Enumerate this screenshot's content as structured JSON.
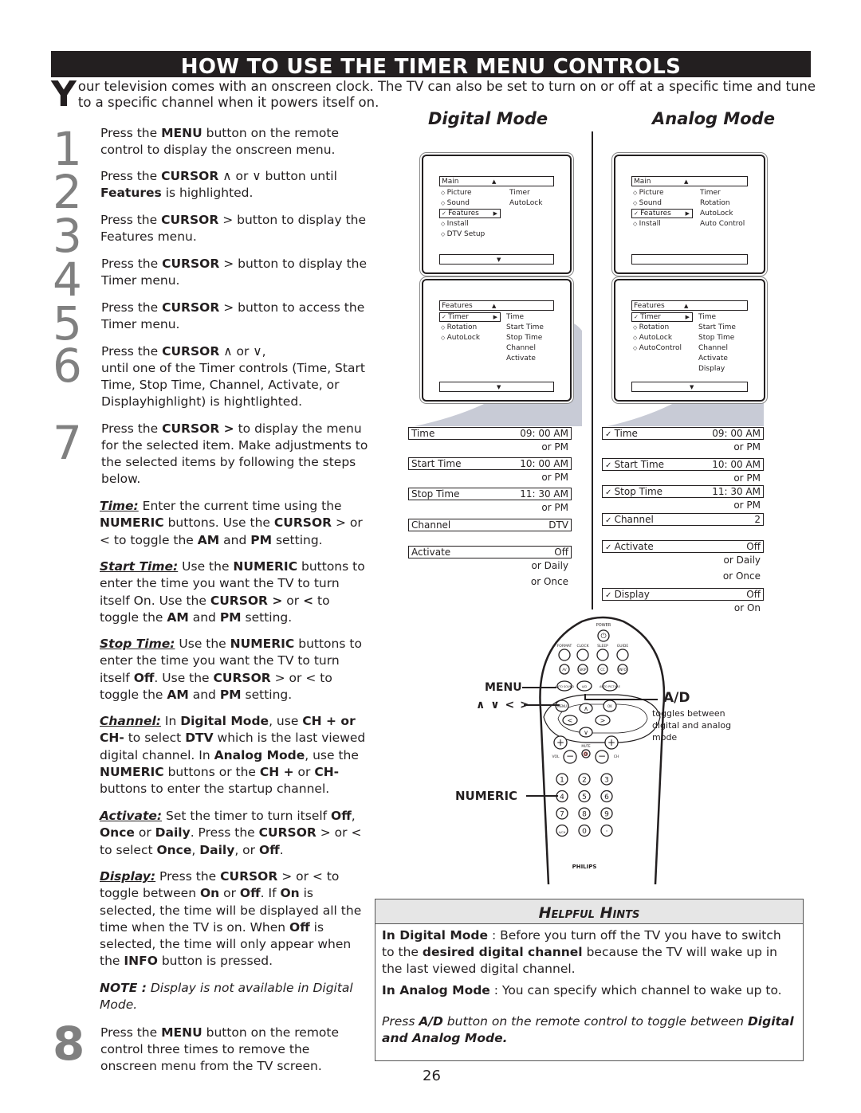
{
  "page": {
    "title": "HOW TO USE THE TIMER MENU CONTROLS",
    "intro_cap": "Y",
    "intro_rest": "our television comes with an onscreen clock. The TV can also be set to turn on or off at a specific time and tune to a specific channel when it powers itself on.",
    "page_number": "26"
  },
  "steps": [
    {
      "num": "1",
      "parts": [
        [
          "Press the ",
          false
        ],
        [
          "MENU",
          true
        ],
        [
          " button on the remote control to display the onscreen menu.",
          false
        ]
      ]
    },
    {
      "num": "2",
      "parts": [
        [
          "Press the ",
          false
        ],
        [
          "CURSOR",
          true
        ],
        [
          " ∧  or ∨ button until ",
          false
        ],
        [
          "Features",
          true
        ],
        [
          " is highlighted.",
          false
        ]
      ]
    },
    {
      "num": "3",
      "parts": [
        [
          "Press the ",
          false
        ],
        [
          "CURSOR",
          true
        ],
        [
          " > button to display the Features menu.",
          false
        ]
      ]
    },
    {
      "num": "4",
      "parts": [
        [
          "Press the ",
          false
        ],
        [
          "CURSOR",
          true
        ],
        [
          " > button to display the Timer menu.",
          false
        ]
      ]
    },
    {
      "num": "5",
      "parts": [
        [
          "Press the ",
          false
        ],
        [
          "CURSOR",
          true
        ],
        [
          " > button to access the Timer menu.",
          false
        ]
      ]
    },
    {
      "num": "6",
      "parts": [
        [
          "Press the ",
          false
        ],
        [
          "CURSOR",
          true
        ],
        [
          " ∧  or ∨,",
          false
        ],
        [
          "\n",
          false
        ],
        [
          "until one of the Timer controls (Time, Start Time, Stop Time, Channel, Activate, or Displayhighlight) is hightlighted.",
          false
        ]
      ]
    },
    {
      "num": "7",
      "parts": [
        [
          "Press the ",
          false
        ],
        [
          "CURSOR >",
          true
        ],
        [
          " to display the menu for the selected item.  Make adjustments to the selected items by following the steps below.",
          false
        ]
      ]
    },
    {
      "num": "8",
      "parts": [
        [
          "Press the ",
          false
        ],
        [
          "MENU",
          true
        ],
        [
          " button on the remote control three times to remove the onscreen menu from the TV screen.",
          false
        ]
      ]
    }
  ],
  "sections": [
    {
      "label": "Time:",
      "parts": [
        [
          " Enter the current time using the ",
          false
        ],
        [
          "NUMERIC",
          true
        ],
        [
          " buttons. Use the ",
          false
        ],
        [
          "CURSOR",
          true
        ],
        [
          " > or < to toggle the ",
          false
        ],
        [
          "AM",
          true
        ],
        [
          " and ",
          false
        ],
        [
          "PM",
          true
        ],
        [
          " setting.",
          false
        ]
      ]
    },
    {
      "label": "Start Time:",
      "parts": [
        [
          " Use the ",
          false
        ],
        [
          "NUMERIC",
          true
        ],
        [
          " buttons to enter      the time you want the TV to turn itself On.  Use the ",
          false
        ],
        [
          "CURSOR >",
          true
        ],
        [
          " or ",
          false
        ],
        [
          "<",
          true
        ],
        [
          " to toggle the ",
          false
        ],
        [
          "AM",
          true
        ],
        [
          " and ",
          false
        ],
        [
          "PM",
          true
        ],
        [
          " setting.",
          false
        ]
      ]
    },
    {
      "label": "Stop Time:",
      "parts": [
        [
          " Use the ",
          false
        ],
        [
          "NUMERIC",
          true
        ],
        [
          " buttons to enter the time you want the TV to turn itself ",
          false
        ],
        [
          "Off",
          true
        ],
        [
          ". Use the ",
          false
        ],
        [
          "CURSOR",
          true
        ],
        [
          " > or < to toggle the ",
          false
        ],
        [
          "AM",
          true
        ],
        [
          " and ",
          false
        ],
        [
          "PM",
          true
        ],
        [
          " setting.",
          false
        ]
      ]
    },
    {
      "label": "Channel:",
      "parts": [
        [
          " In ",
          false
        ],
        [
          "Digital Mode",
          true
        ],
        [
          ", use ",
          false
        ],
        [
          "CH + or CH-",
          true
        ],
        [
          "  to select ",
          false
        ],
        [
          "DTV",
          true
        ],
        [
          " which is the last viewed digital channel.   In ",
          false
        ],
        [
          "Analog Mode",
          true
        ],
        [
          ", use the ",
          false
        ],
        [
          "NUMERIC",
          true
        ],
        [
          " buttons or the ",
          false
        ],
        [
          "CH +",
          true
        ],
        [
          " or ",
          false
        ],
        [
          "CH-",
          true
        ],
        [
          " buttons to enter the startup channel.",
          false
        ]
      ]
    },
    {
      "label": "Activate:",
      "parts": [
        [
          " Set the timer to turn itself ",
          false
        ],
        [
          "Off",
          true
        ],
        [
          ", ",
          false
        ],
        [
          "Once",
          true
        ],
        [
          " or ",
          false
        ],
        [
          "Daily",
          true
        ],
        [
          ". Press the ",
          false
        ],
        [
          "CURSOR",
          true
        ],
        [
          " > or < to select ",
          false
        ],
        [
          "Once",
          true
        ],
        [
          ", ",
          false
        ],
        [
          "Daily",
          true
        ],
        [
          ", or ",
          false
        ],
        [
          "Off",
          true
        ],
        [
          ".",
          false
        ]
      ]
    },
    {
      "label": "Display:",
      "parts": [
        [
          " Press the ",
          false
        ],
        [
          "CURSOR",
          true
        ],
        [
          " > or < to toggle between ",
          false
        ],
        [
          "On",
          true
        ],
        [
          " or ",
          false
        ],
        [
          "Off",
          true
        ],
        [
          ".  If ",
          false
        ],
        [
          "On",
          true
        ],
        [
          " is selected, the time will be displayed all the time when the TV is on.   When ",
          false
        ],
        [
          "Off",
          true
        ],
        [
          " is selected, the time will only appear when the ",
          false
        ],
        [
          "INFO",
          true
        ],
        [
          " button is pressed.",
          false
        ]
      ]
    }
  ],
  "note": {
    "label": "NOTE :",
    "text": " Display is not available in Digital Mode."
  },
  "digital": {
    "title": "Digital Mode",
    "main_menu": {
      "header": "Main",
      "items": [
        "Picture",
        "Sound",
        "Features",
        "Install",
        "DTV Setup"
      ],
      "selected": "Features",
      "sub": [
        "Timer",
        "AutoLock"
      ]
    },
    "features_menu": {
      "header": "Features",
      "items": [
        "Timer",
        "Rotation",
        "AutoLock"
      ],
      "selected": "Timer",
      "sub": [
        "Time",
        "Start Time",
        "Stop Time",
        "Channel",
        "Activate"
      ]
    },
    "fields": [
      {
        "label": "Time",
        "value": "09: 00 AM",
        "alts": [
          "or PM"
        ]
      },
      {
        "label": "Start Time",
        "value": "10: 00 AM",
        "alts": [
          "or PM"
        ]
      },
      {
        "label": "Stop Time",
        "value": "11: 30 AM",
        "alts": [
          "or PM"
        ]
      },
      {
        "label": "Channel",
        "value": "DTV",
        "alts": []
      },
      {
        "label": "Activate",
        "value": "Off",
        "alts": [
          "or Daily",
          "or Once"
        ]
      }
    ]
  },
  "analog": {
    "title": "Analog Mode",
    "main_menu": {
      "header": "Main",
      "items": [
        "Picture",
        "Sound",
        "Features",
        "Install"
      ],
      "selected": "Features",
      "sub": [
        "Timer",
        "Rotation",
        "AutoLock",
        "Auto Control"
      ]
    },
    "features_menu": {
      "header": "Features",
      "items": [
        "Timer",
        "Rotation",
        "AutoLock",
        "AutoControl"
      ],
      "selected": "Timer",
      "sub": [
        "Time",
        "Start Time",
        "Stop Time",
        "Channel",
        "Activate",
        "Display"
      ]
    },
    "fields": [
      {
        "label": "Time",
        "value": "09: 00 AM",
        "alts": [
          "or PM"
        ]
      },
      {
        "label": "Start Time",
        "value": "10: 00 AM",
        "alts": [
          "or PM"
        ]
      },
      {
        "label": "Stop Time",
        "value": "11: 30 AM",
        "alts": [
          "or PM"
        ]
      },
      {
        "label": "Channel",
        "value": "2",
        "alts": []
      },
      {
        "label": "Activate",
        "value": "Off",
        "alts": [
          "or Daily",
          "or Once"
        ]
      },
      {
        "label": "Display",
        "value": "Off",
        "alts": [
          "or On"
        ]
      }
    ]
  },
  "remote": {
    "power": "POWER",
    "row1": [
      "FORMAT",
      "CLOCK",
      "SLEEP",
      "GUIDE"
    ],
    "row2": [
      "AV",
      "SKIP",
      "CC",
      "INFO"
    ],
    "row3": [
      "AUTO SOUND",
      "A/D",
      "AUTO PICTURE"
    ],
    "menu_btn": "MENU",
    "ok_btn": "OK",
    "mute": "MUTE",
    "vol": "VOL",
    "ch": "CH",
    "digits": [
      "1",
      "2",
      "3",
      "4",
      "5",
      "6",
      "7",
      "8",
      "9",
      "A/CH",
      "0",
      "·"
    ],
    "brand": "PHILIPS",
    "callout_menu": "MENU",
    "callout_cursor": "∧  ∨  <  >",
    "callout_numeric": "NUMERIC",
    "callout_ad": "A/D",
    "callout_ad_desc": "toggles between digital and analog mode"
  },
  "hints": {
    "title": "Helpful Hints",
    "p1": [
      [
        "In Digital Mode",
        true
      ],
      [
        " :  Before you turn off the TV you have to switch to the ",
        false
      ],
      [
        "desired digital channel",
        true
      ],
      [
        " because the TV will wake up in the last viewed digital channel.",
        false
      ]
    ],
    "p2": [
      [
        "In Analog Mode",
        true
      ],
      [
        "  :  You can specify which channel to wake up to.",
        false
      ]
    ],
    "p3": [
      [
        "Press ",
        false
      ],
      [
        "A/D",
        true
      ],
      [
        " button on the remote control to toggle between ",
        false
      ],
      [
        "Digital and Analog Mode.",
        true
      ]
    ]
  }
}
